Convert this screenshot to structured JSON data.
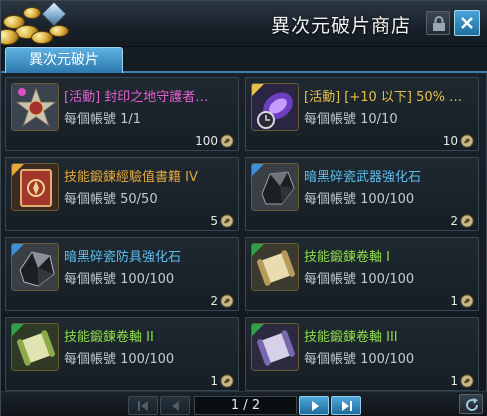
{
  "window": {
    "title": "異次元破片商店"
  },
  "tabs": [
    {
      "label": "異次元破片",
      "active": true
    }
  ],
  "items": [
    {
      "name": "[活動] 封印之地守護者…",
      "name_color": "#e45fd0",
      "limit": "每個帳號 1/1",
      "price": "100",
      "icon": "star-medal-icon"
    },
    {
      "name": "[活動] [+10 以下] 50% …",
      "name_color": "#e6c04a",
      "limit": "每個帳號 10/10",
      "price": "10",
      "icon": "time-scroll-icon"
    },
    {
      "name": "技能鍛鍊經驗值書籍 IV",
      "name_color": "#e6a83a",
      "limit": "每個帳號 50/50",
      "price": "5",
      "icon": "red-book-icon"
    },
    {
      "name": "暗黑碎瓷武器強化石",
      "name_color": "#5cc0f0",
      "limit": "每個帳號 100/100",
      "price": "2",
      "icon": "black-stone-icon"
    },
    {
      "name": "暗黑碎瓷防具強化石",
      "name_color": "#5cc0f0",
      "limit": "每個帳號 100/100",
      "price": "2",
      "icon": "black-stone-icon"
    },
    {
      "name": "技能鍛鍊卷軸 I",
      "name_color": "#8fdd4a",
      "limit": "每個帳號 100/100",
      "price": "1",
      "icon": "scroll-icon"
    },
    {
      "name": "技能鍛鍊卷軸 II",
      "name_color": "#8fdd4a",
      "limit": "每個帳號 100/100",
      "price": "1",
      "icon": "scroll-icon"
    },
    {
      "name": "技能鍛鍊卷軸 III",
      "name_color": "#8fdd4a",
      "limit": "每個帳號 100/100",
      "price": "1",
      "icon": "scroll-icon"
    }
  ],
  "pager": {
    "text": "1 / 2"
  }
}
